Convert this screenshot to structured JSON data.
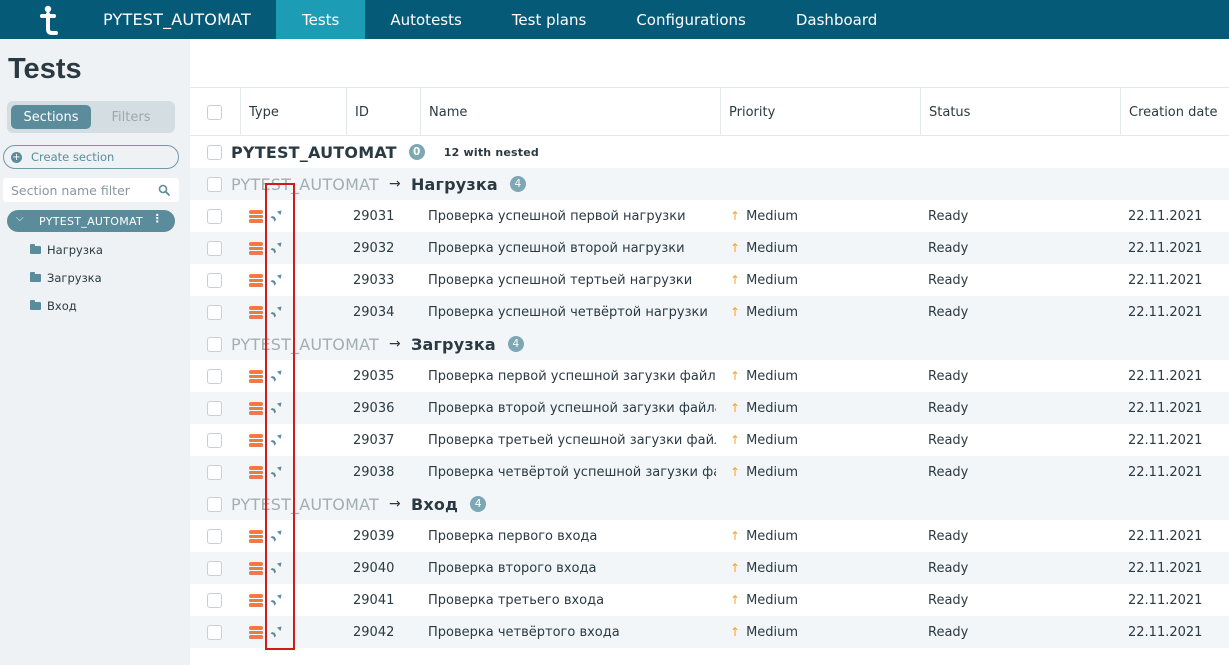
{
  "app": {
    "project": "PYTEST_AUTOMAT",
    "nav": [
      "Tests",
      "Autotests",
      "Test plans",
      "Configurations",
      "Dashboard"
    ]
  },
  "sidebar": {
    "title": "Tests",
    "tabs": {
      "sections": "Sections",
      "filters": "Filters"
    },
    "create_section": "Create section",
    "filter_placeholder": "Section name filter",
    "tree": {
      "root": "PYTEST_AUTOMAT",
      "children": [
        "Нагрузка",
        "Загрузка",
        "Вход"
      ]
    }
  },
  "table": {
    "columns": {
      "type": "Type",
      "id": "ID",
      "name": "Name",
      "priority": "Priority",
      "status": "Status",
      "created": "Creation date"
    },
    "root": {
      "title": "PYTEST_AUTOMAT",
      "count": "0",
      "nested": "12 with nested"
    },
    "groups": [
      {
        "parent": "PYTEST_AUTOMAT",
        "arrow": "→",
        "name": "Нагрузка",
        "count": "4",
        "rows": [
          {
            "id": "29031",
            "name": "Проверка успешной первой нагрузки",
            "priority": "Medium",
            "status": "Ready",
            "date": "22.11.2021"
          },
          {
            "id": "29032",
            "name": "Проверка успешной второй нагрузки",
            "priority": "Medium",
            "status": "Ready",
            "date": "22.11.2021"
          },
          {
            "id": "29033",
            "name": "Проверка успешной тертьей нагрузки",
            "priority": "Medium",
            "status": "Ready",
            "date": "22.11.2021"
          },
          {
            "id": "29034",
            "name": "Проверка успешной четвёртой нагрузки",
            "priority": "Medium",
            "status": "Ready",
            "date": "22.11.2021"
          }
        ]
      },
      {
        "parent": "PYTEST_AUTOMAT",
        "arrow": "→",
        "name": "Загрузка",
        "count": "4",
        "rows": [
          {
            "id": "29035",
            "name": "Проверка первой успешной загузки файла",
            "priority": "Medium",
            "status": "Ready",
            "date": "22.11.2021"
          },
          {
            "id": "29036",
            "name": "Проверка второй успешной загузки файла",
            "priority": "Medium",
            "status": "Ready",
            "date": "22.11.2021"
          },
          {
            "id": "29037",
            "name": "Проверка третьей успешной загузки файла",
            "priority": "Medium",
            "status": "Ready",
            "date": "22.11.2021"
          },
          {
            "id": "29038",
            "name": "Проверка четвёртой успешной загузки фай...",
            "priority": "Medium",
            "status": "Ready",
            "date": "22.11.2021"
          }
        ]
      },
      {
        "parent": "PYTEST_AUTOMAT",
        "arrow": "→",
        "name": "Вход",
        "count": "4",
        "rows": [
          {
            "id": "29039",
            "name": "Проверка первого входа",
            "priority": "Medium",
            "status": "Ready",
            "date": "22.11.2021"
          },
          {
            "id": "29040",
            "name": "Проверка второго входа",
            "priority": "Medium",
            "status": "Ready",
            "date": "22.11.2021"
          },
          {
            "id": "29041",
            "name": "Проверка третьего входа",
            "priority": "Medium",
            "status": "Ready",
            "date": "22.11.2021"
          },
          {
            "id": "29042",
            "name": "Проверка четвёртого входа",
            "priority": "Medium",
            "status": "Ready",
            "date": "22.11.2021"
          }
        ]
      }
    ]
  },
  "icons": {
    "type": "test-case-stack-icon",
    "automation": "automated-rocket-icon",
    "priority": "arrow-up-icon"
  },
  "colors": {
    "topbar": "#055a78",
    "active_tab": "#1d9cb6",
    "accent": "#5b8c9b",
    "type_icon": "#f07a45",
    "priority_arrow": "#f0a030",
    "highlight": "#d11a1a"
  }
}
